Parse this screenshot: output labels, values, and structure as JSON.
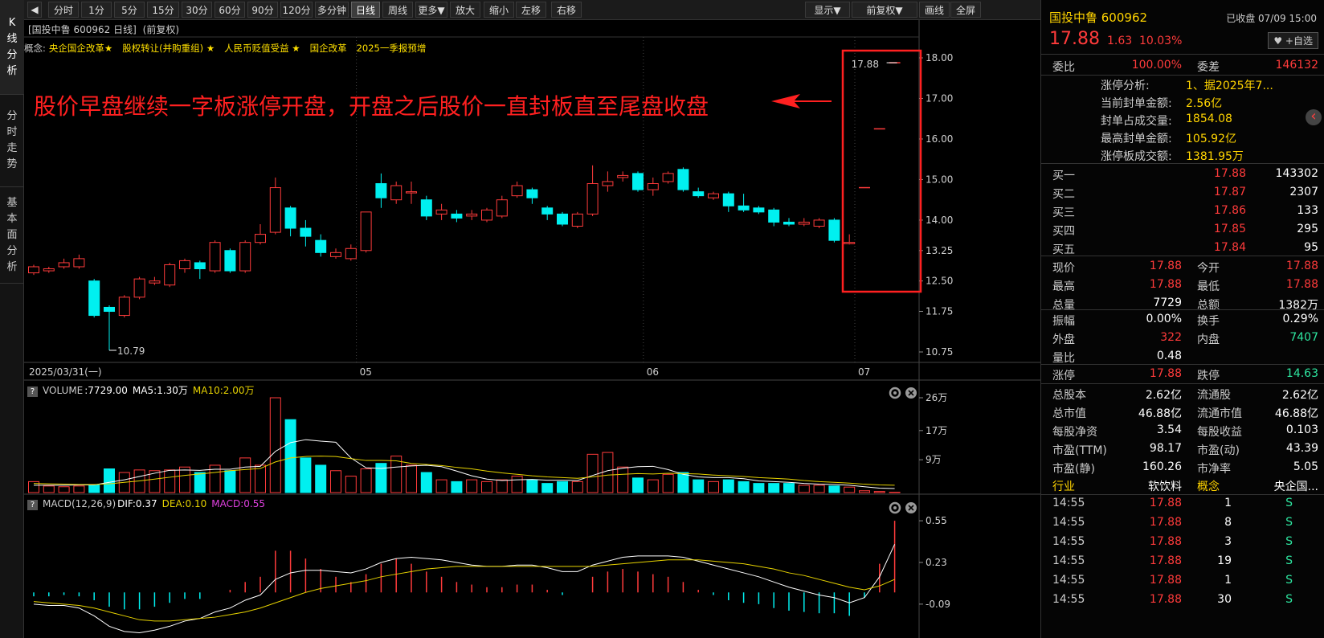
{
  "left_tabs": [
    "K线分析",
    "分时走势",
    "基本面分析"
  ],
  "toolbar": {
    "buttons": [
      "分时",
      "1分",
      "5分",
      "15分",
      "30分",
      "60分",
      "90分",
      "120分",
      "多分钟",
      "日线",
      "周线",
      "更多▼",
      "放大",
      "缩小",
      "左移",
      "右移"
    ],
    "active": "日线",
    "right_buttons": [
      "显示▼",
      "前复权▼",
      "画线",
      "全屏"
    ]
  },
  "chart_header": {
    "title": "[国投中鲁 600962 日线]",
    "adjust": "(前复权)",
    "concept_label": "概念:",
    "concepts": [
      "央企国企改革★",
      "股权转让(并购重组) ★",
      "人民币贬值受益 ★",
      "国企改革",
      "2025一季报预增"
    ]
  },
  "annotation": "股价早盘继续一字板涨停开盘，开盘之后股价一直封板直至尾盘收盘",
  "chart_data": [
    {
      "type": "candlestick",
      "name": "kline",
      "ylim": [
        10.75,
        18.0
      ],
      "yticks": [
        "18.00",
        "17.00",
        "16.00",
        "15.00",
        "14.00",
        "13.25",
        "12.50",
        "11.75",
        "10.75"
      ],
      "xlabels": [
        {
          "i": 0,
          "label": "2025/03/31(一)"
        },
        {
          "i": 22,
          "label": "05"
        },
        {
          "i": 41,
          "label": "06"
        },
        {
          "i": 55,
          "label": "07"
        }
      ],
      "max_label": "17.88",
      "min_label": "10.79",
      "ohlc": [
        [
          12.7,
          12.85,
          12.65,
          12.9
        ],
        [
          12.75,
          12.8,
          12.7,
          12.85
        ],
        [
          12.85,
          12.95,
          12.8,
          13.05
        ],
        [
          12.85,
          13.05,
          12.8,
          13.15
        ],
        [
          12.5,
          11.65,
          11.6,
          12.55
        ],
        [
          11.85,
          11.75,
          10.79,
          11.9
        ],
        [
          11.65,
          12.1,
          11.6,
          12.15
        ],
        [
          12.1,
          12.55,
          12.05,
          12.6
        ],
        [
          12.45,
          12.5,
          12.4,
          12.6
        ],
        [
          12.4,
          12.9,
          12.35,
          12.95
        ],
        [
          12.8,
          13.0,
          12.7,
          13.05
        ],
        [
          12.95,
          12.8,
          12.55,
          13.0
        ],
        [
          12.75,
          13.45,
          12.7,
          13.5
        ],
        [
          13.25,
          12.75,
          12.7,
          13.3
        ],
        [
          12.75,
          13.45,
          12.7,
          13.5
        ],
        [
          13.45,
          13.65,
          13.4,
          13.9
        ],
        [
          13.7,
          14.8,
          13.65,
          15.05
        ],
        [
          14.3,
          13.8,
          13.6,
          14.35
        ],
        [
          13.8,
          13.6,
          13.35,
          14.0
        ],
        [
          13.5,
          13.2,
          13.1,
          13.65
        ],
        [
          13.1,
          13.2,
          13.05,
          13.3
        ],
        [
          13.05,
          13.3,
          13.0,
          13.4
        ],
        [
          13.25,
          14.2,
          13.2,
          14.2
        ],
        [
          14.9,
          14.55,
          14.3,
          15.15
        ],
        [
          14.5,
          14.85,
          14.4,
          14.95
        ],
        [
          14.7,
          14.7,
          14.4,
          14.95
        ],
        [
          14.5,
          14.1,
          14.0,
          14.6
        ],
        [
          14.15,
          14.25,
          14.0,
          14.4
        ],
        [
          14.15,
          14.05,
          13.95,
          14.25
        ],
        [
          14.1,
          14.15,
          14.0,
          14.25
        ],
        [
          14.0,
          14.25,
          13.95,
          14.3
        ],
        [
          14.1,
          14.5,
          14.05,
          14.6
        ],
        [
          14.6,
          14.85,
          14.55,
          14.95
        ],
        [
          14.75,
          14.55,
          14.4,
          14.8
        ],
        [
          14.3,
          14.15,
          14.0,
          14.35
        ],
        [
          14.15,
          13.9,
          13.85,
          14.2
        ],
        [
          13.85,
          14.15,
          13.8,
          14.2
        ],
        [
          14.15,
          14.9,
          14.1,
          15.35
        ],
        [
          14.85,
          14.95,
          14.7,
          15.2
        ],
        [
          15.05,
          15.1,
          14.95,
          15.2
        ],
        [
          15.15,
          14.75,
          14.7,
          15.2
        ],
        [
          14.75,
          14.9,
          14.6,
          15.05
        ],
        [
          14.95,
          15.15,
          14.9,
          15.2
        ],
        [
          15.25,
          14.75,
          14.7,
          15.3
        ],
        [
          14.7,
          14.6,
          14.55,
          14.8
        ],
        [
          14.55,
          14.65,
          14.5,
          14.7
        ],
        [
          14.65,
          14.35,
          14.2,
          14.7
        ],
        [
          14.35,
          14.25,
          14.2,
          14.65
        ],
        [
          14.3,
          14.2,
          14.15,
          14.35
        ],
        [
          14.25,
          13.95,
          13.85,
          14.3
        ],
        [
          13.95,
          13.9,
          13.85,
          14.05
        ],
        [
          13.9,
          13.95,
          13.85,
          14.05
        ],
        [
          13.85,
          14.0,
          13.8,
          14.05
        ],
        [
          14.0,
          13.5,
          13.45,
          14.05
        ],
        [
          13.45,
          13.45,
          13.4,
          13.65
        ],
        [
          14.8,
          14.8,
          14.8,
          14.8
        ],
        [
          16.25,
          16.25,
          16.25,
          16.25
        ],
        [
          17.88,
          17.88,
          17.88,
          17.88
        ]
      ]
    },
    {
      "type": "bar",
      "name": "volume",
      "header": [
        "VOLUME",
        ":7729.00",
        "MA5:1.30万",
        "MA10:2.00万"
      ],
      "yticks": [
        "26万",
        "17万",
        "9万"
      ],
      "ylim": [
        0,
        26
      ],
      "values": [
        3.0,
        1.8,
        1.6,
        1.8,
        2.2,
        6.5,
        5.5,
        6.2,
        6.0,
        6.2,
        7.0,
        5.5,
        7.5,
        6.0,
        9.5,
        7.5,
        26.0,
        20.0,
        9.5,
        7.5,
        6.0,
        4.5,
        6.5,
        8.0,
        10.0,
        7.5,
        5.5,
        3.5,
        3.0,
        3.5,
        3.0,
        3.5,
        4.5,
        3.5,
        2.5,
        3.0,
        3.0,
        10.5,
        11.0,
        7.0,
        4.0,
        3.5,
        5.0,
        5.5,
        3.5,
        3.0,
        3.5,
        3.0,
        2.5,
        2.5,
        2.5,
        2.0,
        2.0,
        1.8,
        1.5,
        0.5,
        0.3,
        0.08
      ],
      "ma5": [
        2.0,
        2.0,
        2.0,
        2.1,
        2.1,
        2.8,
        3.5,
        4.4,
        5.3,
        6.1,
        6.2,
        6.1,
        6.4,
        6.4,
        7.0,
        7.2,
        11.3,
        13.7,
        14.5,
        14.1,
        13.8,
        9.5,
        6.8,
        6.6,
        7.0,
        7.3,
        7.5,
        7.1,
        5.9,
        4.6,
        3.7,
        3.3,
        3.5,
        3.6,
        3.4,
        3.4,
        3.3,
        4.7,
        6.0,
        6.7,
        7.1,
        7.2,
        6.3,
        5.0,
        4.3,
        4.1,
        4.1,
        3.8,
        3.2,
        3.0,
        2.8,
        2.5,
        2.3,
        2.2,
        2.0,
        1.6,
        1.2,
        1.1
      ],
      "ma10": [
        2.5,
        2.4,
        2.3,
        2.2,
        2.2,
        2.4,
        2.8,
        3.2,
        3.7,
        4.2,
        4.7,
        5.1,
        5.5,
        6.0,
        6.3,
        6.6,
        8.4,
        9.5,
        9.9,
        10.0,
        9.9,
        9.3,
        8.8,
        8.8,
        8.7,
        8.0,
        7.7,
        7.4,
        6.9,
        6.5,
        5.9,
        5.4,
        5.0,
        4.6,
        4.3,
        4.1,
        3.9,
        4.3,
        4.8,
        5.0,
        5.2,
        5.1,
        5.3,
        5.2,
        5.1,
        4.8,
        4.6,
        4.4,
        4.1,
        3.9,
        3.7,
        3.3,
        3.0,
        2.8,
        2.6,
        2.3,
        2.1,
        2.0
      ]
    },
    {
      "type": "bar",
      "name": "macd",
      "header": [
        "MACD(12,26,9)",
        "DIF:0.37",
        "DEA:0.10",
        "MACD:0.55"
      ],
      "yticks": [
        "0.55",
        "0.23",
        "-0.09"
      ],
      "ylim": [
        -0.35,
        0.6
      ],
      "macd": [
        -0.03,
        -0.03,
        -0.02,
        -0.03,
        -0.06,
        -0.11,
        -0.13,
        -0.13,
        -0.11,
        -0.08,
        -0.05,
        -0.05,
        0.0,
        0.02,
        0.08,
        0.12,
        0.32,
        0.32,
        0.26,
        0.18,
        0.12,
        0.08,
        0.14,
        0.22,
        0.26,
        0.22,
        0.16,
        0.12,
        0.08,
        0.06,
        0.04,
        0.04,
        0.06,
        0.06,
        0.02,
        -0.02,
        0.0,
        0.12,
        0.16,
        0.18,
        0.16,
        0.14,
        0.12,
        0.08,
        0.02,
        -0.02,
        -0.06,
        -0.08,
        -0.09,
        -0.12,
        -0.14,
        -0.15,
        -0.16,
        -0.16,
        -0.18,
        -0.04,
        0.22,
        0.55
      ],
      "dif": [
        -0.09,
        -0.1,
        -0.1,
        -0.12,
        -0.18,
        -0.26,
        -0.3,
        -0.31,
        -0.29,
        -0.26,
        -0.22,
        -0.2,
        -0.15,
        -0.12,
        -0.06,
        -0.02,
        0.1,
        0.15,
        0.17,
        0.17,
        0.16,
        0.15,
        0.18,
        0.23,
        0.26,
        0.27,
        0.26,
        0.25,
        0.23,
        0.21,
        0.2,
        0.2,
        0.21,
        0.21,
        0.19,
        0.16,
        0.16,
        0.21,
        0.24,
        0.27,
        0.28,
        0.28,
        0.28,
        0.27,
        0.24,
        0.21,
        0.18,
        0.15,
        0.12,
        0.08,
        0.04,
        0.01,
        -0.02,
        -0.04,
        -0.08,
        -0.04,
        0.12,
        0.37
      ],
      "dea": [
        -0.07,
        -0.08,
        -0.09,
        -0.1,
        -0.12,
        -0.15,
        -0.18,
        -0.21,
        -0.22,
        -0.22,
        -0.21,
        -0.2,
        -0.19,
        -0.17,
        -0.15,
        -0.12,
        -0.08,
        -0.04,
        0.0,
        0.03,
        0.05,
        0.07,
        0.09,
        0.12,
        0.14,
        0.16,
        0.18,
        0.19,
        0.2,
        0.2,
        0.2,
        0.2,
        0.2,
        0.2,
        0.2,
        0.2,
        0.2,
        0.2,
        0.21,
        0.22,
        0.23,
        0.24,
        0.25,
        0.25,
        0.25,
        0.24,
        0.23,
        0.22,
        0.2,
        0.18,
        0.15,
        0.13,
        0.1,
        0.07,
        0.04,
        0.02,
        0.05,
        0.1
      ]
    }
  ],
  "colors": {
    "up": "#ff3b3b",
    "down": "#00f0f0",
    "ma5": "#ffffff",
    "ma10": "#e6d200",
    "dea": "#e6d200",
    "macd_label": "#e040e0",
    "annotation": "#ff2020"
  },
  "quote": {
    "name": "国投中鲁 600962",
    "status": "已收盘 07/09 15:00",
    "price": "17.88",
    "change": "1.63",
    "pct": "10.03%",
    "watch": "+自选",
    "weibi_label": "委比",
    "weibi": "100.00%",
    "weicha_label": "委差",
    "weicha": "146132",
    "limit_info": [
      {
        "label": "涨停分析:",
        "value": "1、据2025年7..."
      },
      {
        "label": "当前封单金额:",
        "value": "2.56亿"
      },
      {
        "label": "封单占成交量:",
        "value": "1854.08"
      },
      {
        "label": "最高封单金额:",
        "value": "105.92亿"
      },
      {
        "label": "涨停板成交额:",
        "value": "1381.95万"
      }
    ],
    "bids": [
      {
        "label": "买一",
        "price": "17.88",
        "vol": "143302"
      },
      {
        "label": "买二",
        "price": "17.87",
        "vol": "2307"
      },
      {
        "label": "买三",
        "price": "17.86",
        "vol": "133"
      },
      {
        "label": "买四",
        "price": "17.85",
        "vol": "295"
      },
      {
        "label": "买五",
        "price": "17.84",
        "vol": "95"
      }
    ],
    "stats1": [
      [
        "现价",
        "17.88",
        "今开",
        "17.88"
      ],
      [
        "最高",
        "17.88",
        "最低",
        "17.88"
      ],
      [
        "总量",
        "7729",
        "总额",
        "1382万"
      ]
    ],
    "stats2": [
      [
        "振幅",
        "0.00%",
        "换手",
        "0.29%"
      ],
      [
        "外盘",
        "322",
        "内盘",
        "7407"
      ],
      [
        "量比",
        "0.48",
        "",
        ""
      ]
    ],
    "stats3": [
      [
        "涨停",
        "17.88",
        "跌停",
        "14.63"
      ]
    ],
    "stats4": [
      [
        "总股本",
        "2.62亿",
        "流通股",
        "2.62亿"
      ],
      [
        "总市值",
        "46.88亿",
        "流通市值",
        "46.88亿"
      ],
      [
        "每股净资",
        "3.54",
        "每股收益",
        "0.103"
      ],
      [
        "市盈(TTM)",
        "98.17",
        "市盈(动)",
        "43.39"
      ],
      [
        "市盈(静)",
        "160.26",
        "市净率",
        "5.05"
      ]
    ],
    "industry": [
      "行业",
      "软饮料",
      "概念",
      "央企国..."
    ],
    "ticks": [
      [
        "14:55",
        "17.88",
        "1",
        "S"
      ],
      [
        "14:55",
        "17.88",
        "8",
        "S"
      ],
      [
        "14:55",
        "17.88",
        "3",
        "S"
      ],
      [
        "14:55",
        "17.88",
        "19",
        "S"
      ],
      [
        "14:55",
        "17.88",
        "1",
        "S"
      ],
      [
        "14:55",
        "17.88",
        "30",
        "S"
      ]
    ]
  }
}
